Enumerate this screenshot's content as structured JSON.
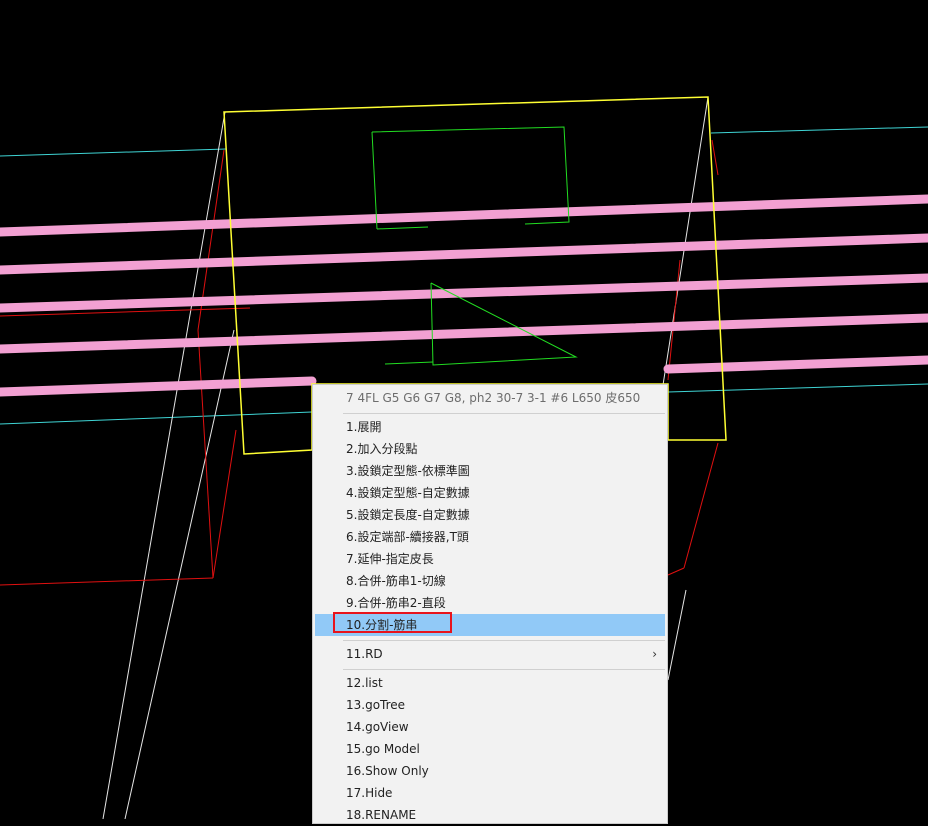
{
  "colors": {
    "background": "#000000",
    "cyan_line": "#3fd4d4",
    "white_line": "#e6e6e6",
    "red_line": "#e01010",
    "yellow_outline": "#ffff33",
    "green_line": "#22dd22",
    "rebar_pink": "#f2a0d2",
    "menu_bg": "#f2f2f2",
    "menu_selected": "#91c9f7",
    "highlight": "#e8141c"
  },
  "context_menu": {
    "header": "7 4FL G5 G6 G7 G8, ph2 30-7 3-1 #6 L650 皮650",
    "group1": [
      {
        "label": "1.展開"
      },
      {
        "label": "2.加入分段點"
      },
      {
        "label": "3.設鎖定型態-依標準圖"
      },
      {
        "label": "4.設鎖定型態-自定數據"
      },
      {
        "label": "5.設鎖定長度-自定數據"
      },
      {
        "label": "6.設定端部-續接器,T頭"
      },
      {
        "label": "7.延伸-指定皮長"
      },
      {
        "label": "8.合併-筋串1-切線"
      },
      {
        "label": "9.合併-筋串2-直段"
      },
      {
        "label": "10.分割-筋串",
        "selected": true
      }
    ],
    "group2": [
      {
        "label": "11.RD",
        "submenu_arrow": "›"
      }
    ],
    "group3": [
      {
        "label": "12.list"
      },
      {
        "label": "13.goTree"
      },
      {
        "label": "14.goView"
      },
      {
        "label": "15.go Model"
      },
      {
        "label": "16.Show Only"
      },
      {
        "label": "17.Hide"
      },
      {
        "label": "18.RENAME"
      }
    ]
  }
}
